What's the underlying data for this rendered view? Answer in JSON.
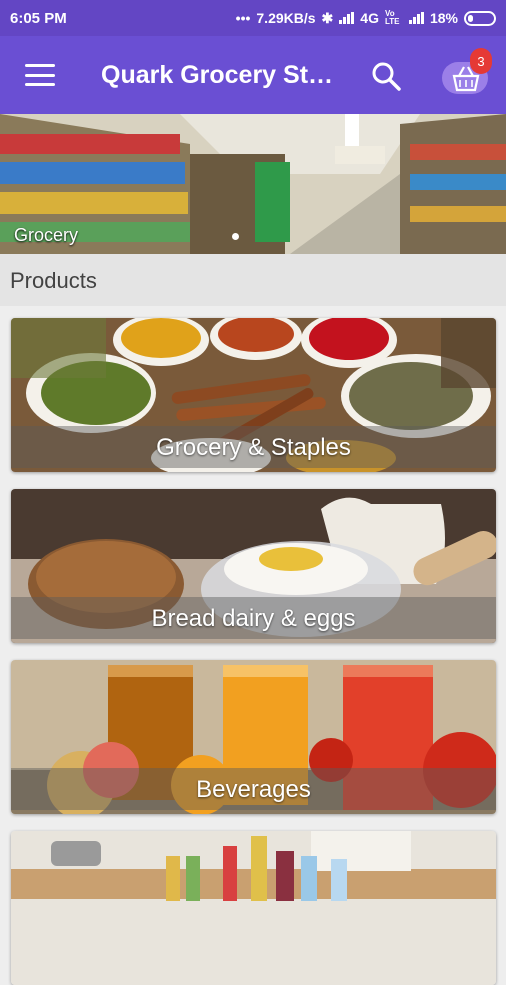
{
  "status_bar": {
    "time": "6:05 PM",
    "net_speed": "7.29KB/s",
    "network_4g": "4G",
    "volte": "Vo LTE",
    "battery": "18%"
  },
  "app_bar": {
    "title": "Quark Grocery Store",
    "cart_count": "3",
    "icons": {
      "menu": "hamburger-menu-icon",
      "search": "search-icon",
      "cart": "basket-icon"
    }
  },
  "banner": {
    "caption": "Grocery",
    "pages": 2,
    "active_page": 1
  },
  "products_header": "Products",
  "categories": [
    {
      "label": "Grocery & Staples"
    },
    {
      "label": "Bread dairy & eggs"
    },
    {
      "label": "Beverages"
    },
    {
      "label": ""
    }
  ],
  "colors": {
    "status_bar": "#6346c4",
    "app_bar": "#6a4fd3",
    "badge": "#e53935"
  }
}
